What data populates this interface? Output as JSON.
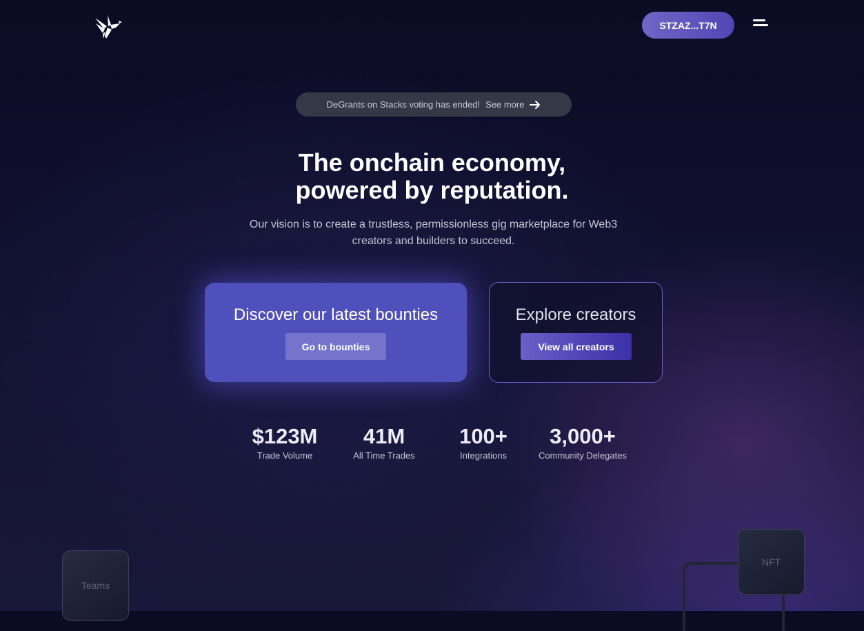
{
  "header": {
    "logo_name": "bird-logo",
    "wallet_label": "STZAZ...T7N",
    "menu_icon": "hamburger-menu-icon"
  },
  "banner": {
    "text": "DeGrants on Stacks voting has ended!",
    "link_label": "See more",
    "icon": "arrow-right-icon"
  },
  "hero": {
    "headline_line1": "The onchain economy,",
    "headline_line2": "powered by reputation.",
    "subtitle_line1": "Our vision is to create a trustless, permissionless gig marketplace for Web3",
    "subtitle_line2": "creators and builders to succeed."
  },
  "cards": {
    "bounties": {
      "title": "Discover our latest bounties",
      "button_label": "Go to bounties"
    },
    "creators": {
      "title": "Explore creators",
      "button_label": "View all creators"
    }
  },
  "stats": [
    {
      "value": "$123M",
      "label": "Trade Volume"
    },
    {
      "value": "41M",
      "label": "All Time Trades"
    },
    {
      "value": "100+",
      "label": "Integrations"
    },
    {
      "value": "3,000+",
      "label": "Community Delegates"
    }
  ],
  "tiles": {
    "teams": "Teams",
    "nft": "NFT"
  },
  "colors": {
    "background": "#0b0b24",
    "accent": "#5050bd",
    "wallet_button": "#6a60c2",
    "banner": "#353846"
  }
}
